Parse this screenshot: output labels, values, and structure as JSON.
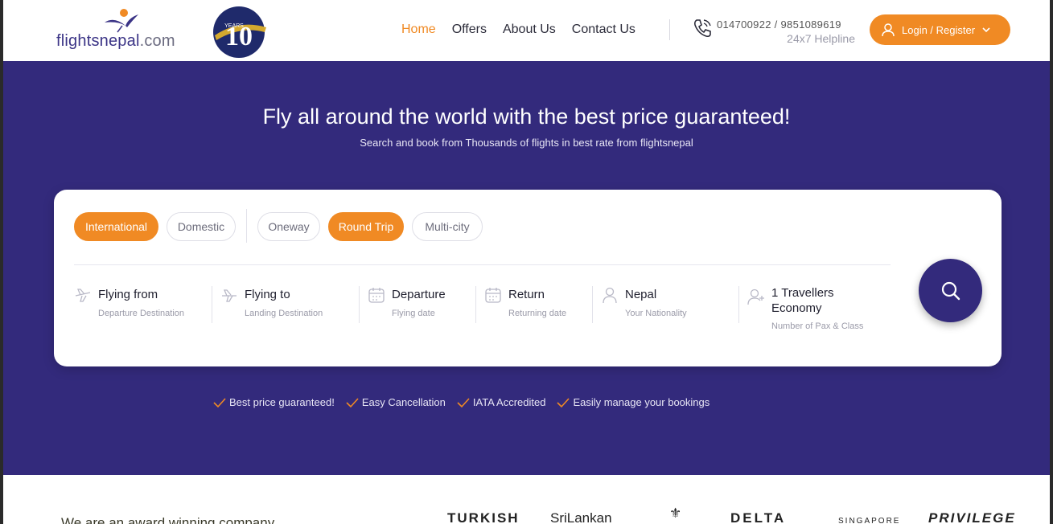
{
  "header": {
    "logo_main": "flightsnepal",
    "logo_suffix": ".com",
    "badge_alt": "10 YEARS",
    "nav": [
      {
        "label": "Home",
        "active": true
      },
      {
        "label": "Offers",
        "active": false
      },
      {
        "label": "About Us",
        "active": false
      },
      {
        "label": "Contact Us",
        "active": false
      }
    ],
    "phones": "014700922  /  9851089619",
    "helpline_label": "24x7 Helpline",
    "login_label": "Login / Register"
  },
  "hero": {
    "title": "Fly all around the world with the best price guaranteed!",
    "subtitle": "Search and book from Thousands of flights in best rate from flightsnepal"
  },
  "search": {
    "scope": [
      {
        "label": "International",
        "selected": true
      },
      {
        "label": "Domestic",
        "selected": false
      }
    ],
    "trip_type": [
      {
        "label": "Oneway",
        "selected": false
      },
      {
        "label": "Round Trip",
        "selected": true
      },
      {
        "label": "Multi-city",
        "selected": false
      }
    ],
    "fields": {
      "from": {
        "main": "Flying from",
        "sub": "Departure Destination"
      },
      "to": {
        "main": "Flying to",
        "sub": "Landing Destination"
      },
      "departure": {
        "main": "Departure",
        "sub": "Flying date"
      },
      "return": {
        "main": "Return",
        "sub": "Returning date"
      },
      "nationality": {
        "main": "Nepal",
        "sub": "Your Nationality"
      },
      "travellers": {
        "main_line1": "1 Travellers",
        "main_line2": "Economy",
        "sub": "Number of Pax & Class"
      }
    }
  },
  "features": [
    "Best price guaranteed!",
    "Easy Cancellation",
    "IATA Accredited",
    "Easily manage your bookings"
  ],
  "bottom": {
    "award_text": "We are an award winning company",
    "airlines": [
      "TURKISH",
      "SriLankan",
      "DELTA",
      "SINGAPORE",
      "PRIVILEGE"
    ]
  },
  "colors": {
    "brand_purple": "#332a7c",
    "accent_orange": "#f08a24"
  }
}
